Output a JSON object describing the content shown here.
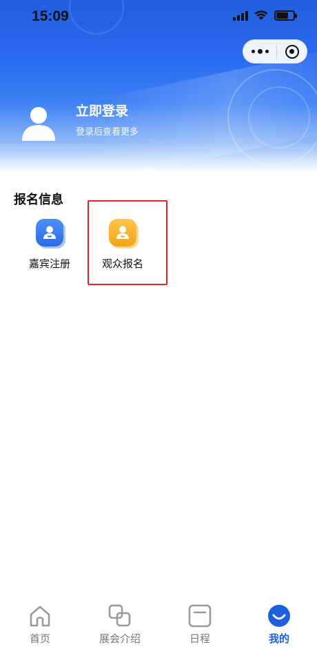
{
  "status_bar": {
    "time": "15:09"
  },
  "header": {
    "login_title": "立即登录",
    "login_subtitle": "登录后查看更多"
  },
  "registration": {
    "section_title": "报名信息",
    "items": [
      {
        "label": "嘉宾注册",
        "icon": "guest-user-icon",
        "color": "#2a6ae6"
      },
      {
        "label": "观众报名",
        "icon": "audience-user-icon",
        "color": "#f3a31c"
      }
    ]
  },
  "tabbar": {
    "active_color": "#1d5fe0",
    "tabs": [
      {
        "label": "首页",
        "icon": "home-icon"
      },
      {
        "label": "展会介绍",
        "icon": "overlap-squares-icon"
      },
      {
        "label": "日程",
        "icon": "calendar-icon"
      },
      {
        "label": "我的",
        "icon": "smile-icon"
      }
    ]
  }
}
